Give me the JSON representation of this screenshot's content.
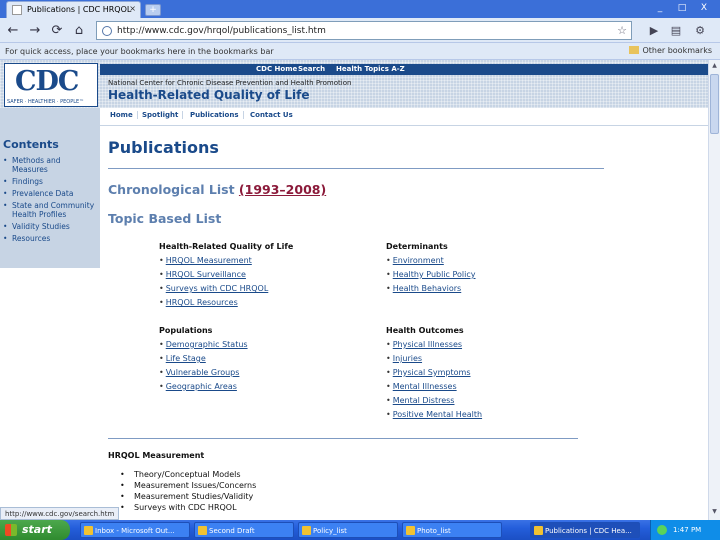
{
  "browser": {
    "tab_title": "Publications | CDC HRQOL",
    "new_tab_label": "+",
    "url": "http://www.cdc.gov/hrqol/publications_list.htm",
    "bookmarks_prompt": "For quick access, place your bookmarks here in the bookmarks bar",
    "other_bookmarks": "Other bookmarks",
    "status_url": "http://www.cdc.gov/search.htm",
    "window_controls": {
      "minimize": "_",
      "maximize": "□",
      "close": "X"
    },
    "nav_icons": {
      "back": "←",
      "forward": "→",
      "reload": "⟳",
      "home": "⌂",
      "star": "☆",
      "go": "▶",
      "page": "▤",
      "wrench": "⚙"
    }
  },
  "site": {
    "logo_text": "CDC",
    "logo_tagline": "SAFER · HEALTHIER · PEOPLE™",
    "top_nav": [
      "CDC Home",
      "Search",
      "Health Topics A-Z"
    ],
    "center_name": "National Center for Chronic Disease Prevention and Health Promotion",
    "program_title": "Health-Related Quality of Life",
    "subnav": [
      "Home",
      "Spotlight",
      "Publications",
      "Contact Us"
    ]
  },
  "sidebar": {
    "title": "Contents",
    "items": [
      "Methods and Measures",
      "Findings",
      "Prevalence Data",
      "State and Community Health Profiles",
      "Validity Studies",
      "Resources"
    ]
  },
  "content": {
    "heading": "Publications",
    "chron_label": "Chronological List",
    "chron_range": "(1993–2008)",
    "topic_heading": "Topic Based List",
    "groups": [
      {
        "title": "Health-Related Quality of Life",
        "items": [
          "HRQOL Measurement",
          "HRQOL Surveillance",
          "Surveys with CDC HRQOL",
          "HRQOL Resources"
        ]
      },
      {
        "title": "Determinants",
        "items": [
          "Environment",
          "Healthy Public Policy",
          "Health Behaviors"
        ]
      },
      {
        "title": "Populations",
        "items": [
          "Demographic Status",
          "Life Stage",
          "Vulnerable Groups",
          "Geographic Areas"
        ]
      },
      {
        "title": "Health Outcomes",
        "items": [
          "Physical Illnesses",
          "Injuries",
          "Physical Symptoms",
          "Mental Illnesses",
          "Mental Distress",
          "Positive Mental Health"
        ]
      }
    ],
    "hrqol_heading": "HRQOL Measurement",
    "hrqol_items": [
      "Theory/Conceptual Models",
      "Measurement Issues/Concerns",
      "Measurement Studies/Validity",
      "Surveys with CDC HRQOL"
    ]
  },
  "taskbar": {
    "start_label": "start",
    "tasks": [
      "Inbox - Microsoft Out...",
      "Second Draft",
      "Policy_list",
      "Photo_list",
      "Publications | CDC Hea..."
    ],
    "clock": "1:47 PM"
  }
}
